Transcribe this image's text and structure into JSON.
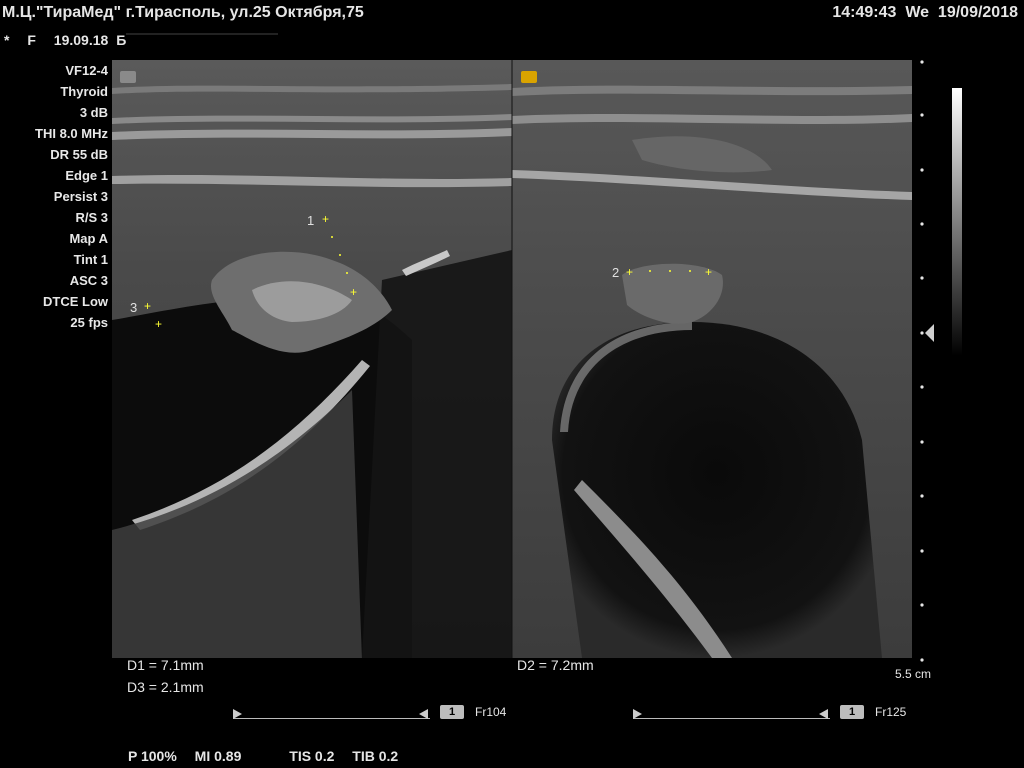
{
  "header": {
    "clinic": "М.Ц.\"ТираМед\" г.Тирасполь, ул.25 Октября,75",
    "time": "14:49:43",
    "weekday": "We",
    "date": "19/09/2018",
    "marker": "*",
    "sex": "F",
    "exam_date": "19.09.18",
    "patient_initial": "Б"
  },
  "params": [
    "VF12-4",
    "Thyroid",
    "3 dB",
    "THI 8.0 MHz",
    "DR 55 dB",
    "Edge 1",
    "Persist 3",
    "R/S 3",
    "Map A",
    "Tint 1",
    "ASC 3",
    "DTCE Low",
    "25 fps"
  ],
  "calipers": {
    "c1": "1",
    "c2": "2",
    "c3": "3"
  },
  "measurements": {
    "d1": "D1 = 7.1mm",
    "d3": "D3 = 2.1mm",
    "d2": "D2 = 7.2mm"
  },
  "depth": "5.5 cm",
  "cine": {
    "left": {
      "badge": "1",
      "frame": "Fr104"
    },
    "right": {
      "badge": "1",
      "frame": "Fr125"
    }
  },
  "footer": {
    "power": "P 100%",
    "mi": "MI 0.89",
    "tis": "TIS 0.2",
    "tib": "TIB 0.2"
  },
  "colors": {
    "caliper": "#ffff33",
    "orientation_right": "#d9a300",
    "orientation_left": "#8a8a8a"
  }
}
